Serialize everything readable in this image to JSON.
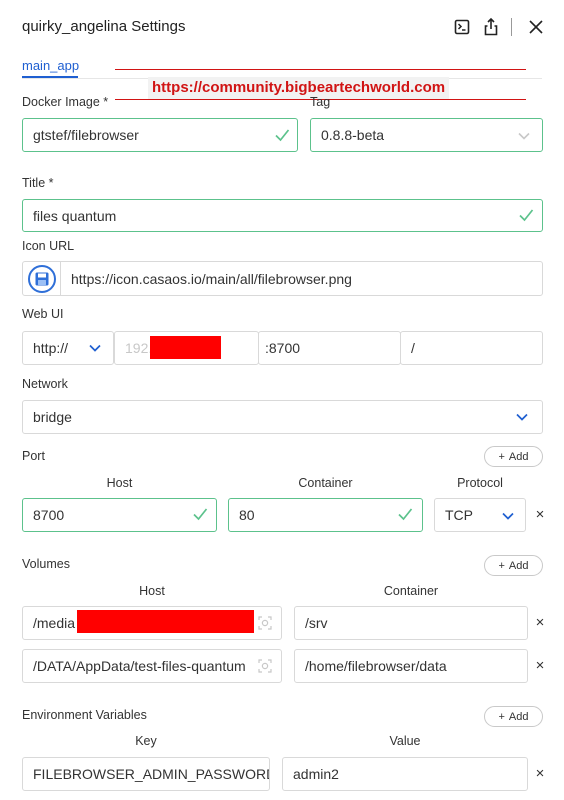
{
  "header": {
    "title": "quirky_angelina Settings",
    "terminal_icon": "terminal-icon",
    "export_icon": "share-export-icon",
    "close_icon": "close-icon"
  },
  "tabs": [
    {
      "label": "main_app",
      "active": true
    }
  ],
  "watermark": {
    "text": "https://community.bigbeartechworld.com",
    "color": "#d11414"
  },
  "docker_image": {
    "label": "Docker Image *",
    "value": "gtstef/filebrowser"
  },
  "tag": {
    "label": "Tag",
    "value": "0.8.8-beta"
  },
  "title_field": {
    "label": "Title *",
    "value": "files quantum"
  },
  "icon_url": {
    "label": "Icon URL",
    "value": "https://icon.casaos.io/main/all/filebrowser.png",
    "icon": "save-disk-icon"
  },
  "web_ui": {
    "label": "Web UI",
    "scheme": "http://",
    "host": "192.",
    "port": ":8700",
    "path": "/"
  },
  "network": {
    "label": "Network",
    "value": "bridge"
  },
  "port": {
    "label": "Port",
    "add_label": "Add",
    "col_host": "Host",
    "col_container": "Container",
    "col_protocol": "Protocol",
    "rows": [
      {
        "host": "8700",
        "container": "80",
        "protocol": "TCP"
      }
    ]
  },
  "volumes": {
    "label": "Volumes",
    "add_label": "Add",
    "col_host": "Host",
    "col_container": "Container",
    "rows": [
      {
        "host": "/media",
        "container": "/srv"
      },
      {
        "host": "/DATA/AppData/test-files-quantum",
        "container": "/home/filebrowser/data"
      }
    ]
  },
  "env": {
    "label": "Environment Variables",
    "add_label": "Add",
    "col_key": "Key",
    "col_value": "Value",
    "rows": [
      {
        "key": "FILEBROWSER_ADMIN_PASSWORD",
        "value": "admin2"
      }
    ]
  },
  "colors": {
    "accent": "#1f5fd1",
    "valid": "#5cc28c",
    "redaction": "#ff0000"
  }
}
